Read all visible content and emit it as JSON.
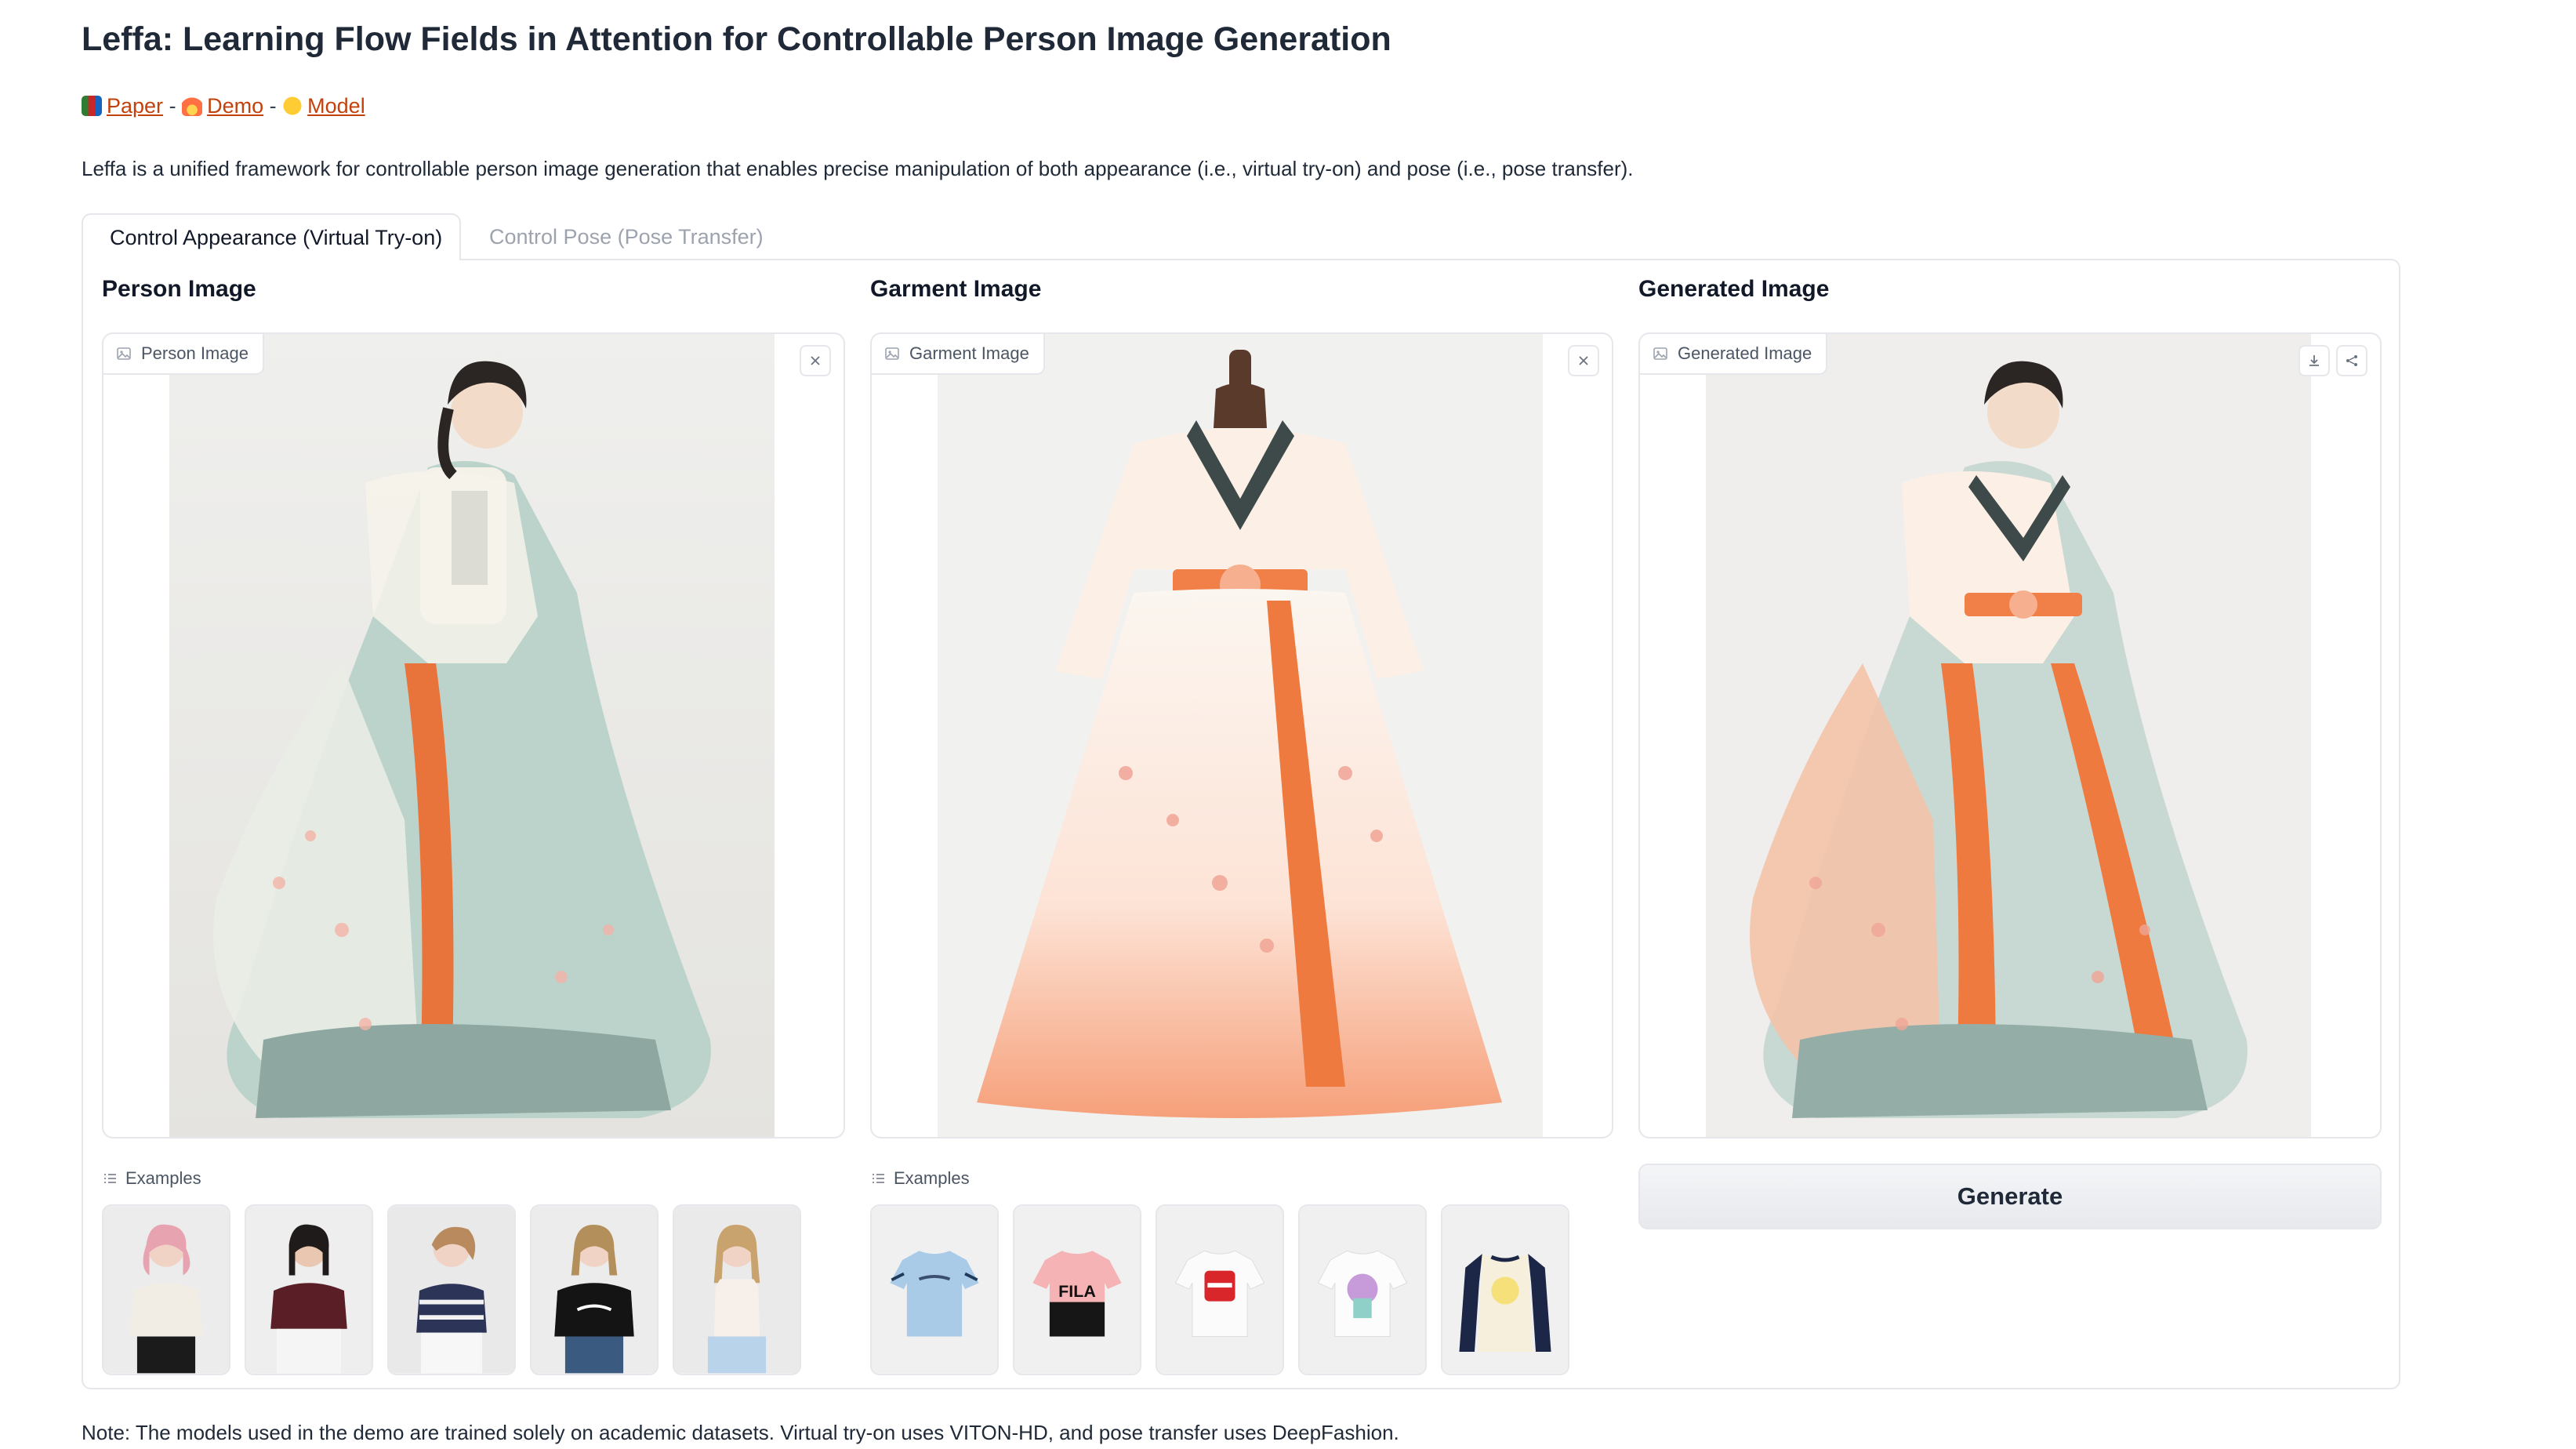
{
  "header": {
    "title": "Leffa: Learning Flow Fields in Attention for Controllable Person Image Generation",
    "links": [
      {
        "label": "Paper",
        "icon": "books-emoji-icon"
      },
      {
        "label": "Demo",
        "icon": "fire-emoji-icon"
      },
      {
        "label": "Model",
        "icon": "hugging-face-emoji-icon"
      }
    ],
    "separator": "-",
    "description": "Leffa is a unified framework for controllable person image generation that enables precise manipulation of both appearance (i.e., virtual try-on) and pose (i.e., pose transfer)."
  },
  "tabs": [
    {
      "label": "Control Appearance (Virtual Try-on)",
      "active": true
    },
    {
      "label": "Control Pose (Pose Transfer)",
      "active": false
    }
  ],
  "columns": {
    "person": {
      "title": "Person Image",
      "image_label": "Person Image",
      "examples_label": "Examples"
    },
    "garment": {
      "title": "Garment Image",
      "image_label": "Garment Image",
      "examples_label": "Examples"
    },
    "generated": {
      "title": "Generated Image",
      "image_label": "Generated Image"
    }
  },
  "garment_examples": {
    "fila_text": "FILA"
  },
  "generate_button": {
    "label": "Generate"
  },
  "footer_note": "Note: The models used in the demo are trained solely on academic datasets. Virtual try-on uses VITON-HD, and pose transfer uses DeepFashion.",
  "colors": {
    "link": "#c2410c",
    "border": "#e5e7eb",
    "button_bg": "#eceef1",
    "orange_sash": "#f08048",
    "sage_skirt": "#bcd3cc"
  }
}
